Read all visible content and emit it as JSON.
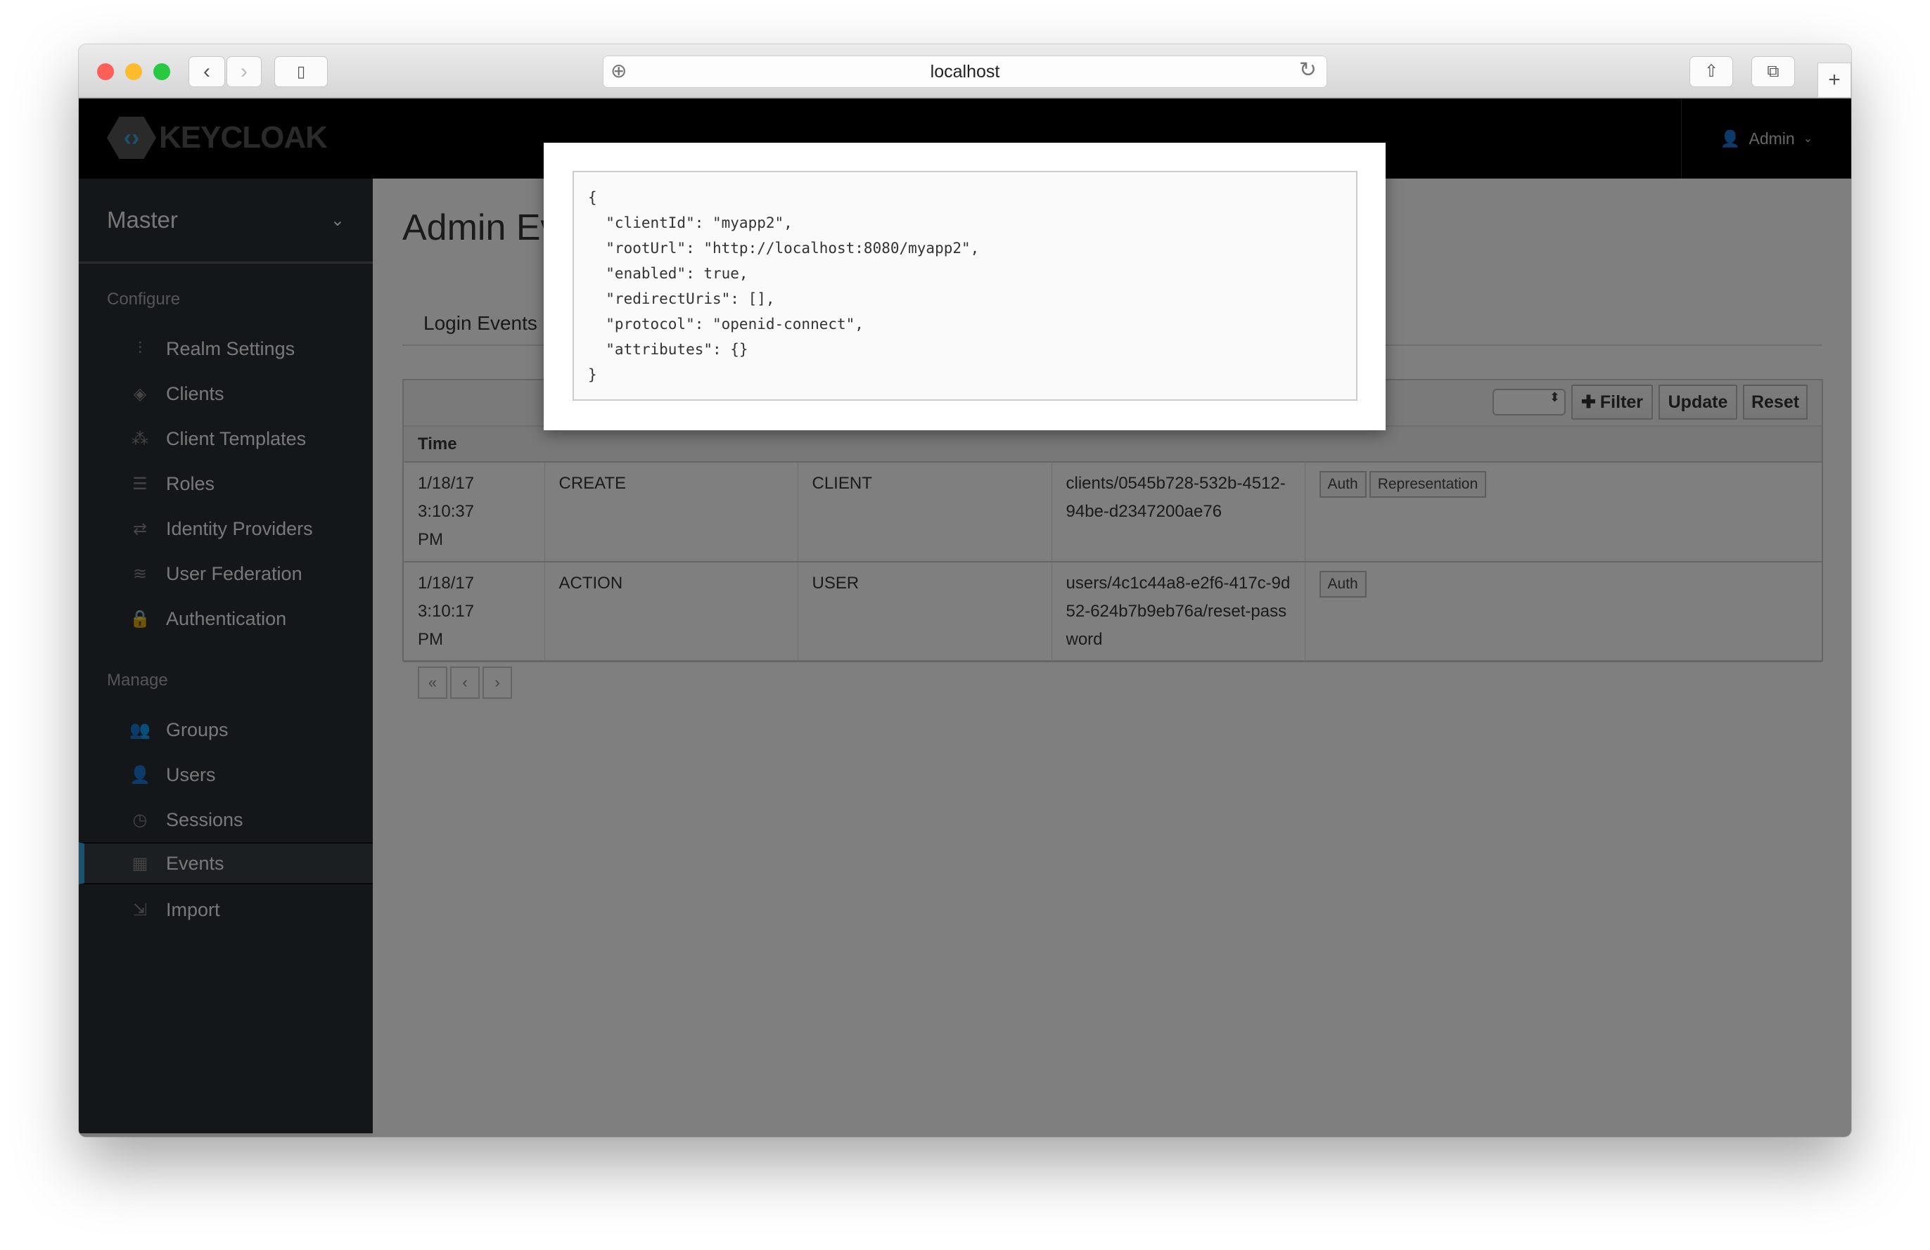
{
  "browser": {
    "url": "localhost"
  },
  "header": {
    "logo": "KEYCLOAK",
    "user": "Admin"
  },
  "sidebar": {
    "realm": "Master",
    "configure_label": "Configure",
    "manage_label": "Manage",
    "configure": [
      {
        "label": "Realm Settings",
        "icon": "sliders-icon"
      },
      {
        "label": "Clients",
        "icon": "cube-icon"
      },
      {
        "label": "Client Templates",
        "icon": "cubes-icon"
      },
      {
        "label": "Roles",
        "icon": "list-icon"
      },
      {
        "label": "Identity Providers",
        "icon": "exchange-icon"
      },
      {
        "label": "User Federation",
        "icon": "database-icon"
      },
      {
        "label": "Authentication",
        "icon": "lock-icon"
      }
    ],
    "manage": [
      {
        "label": "Groups",
        "icon": "users-icon"
      },
      {
        "label": "Users",
        "icon": "user-icon"
      },
      {
        "label": "Sessions",
        "icon": "clock-icon"
      },
      {
        "label": "Events",
        "icon": "calendar-icon",
        "active": true
      },
      {
        "label": "Import",
        "icon": "import-icon"
      }
    ]
  },
  "main": {
    "title": "Admin Ev",
    "tabs": [
      {
        "label": "Login Events"
      }
    ],
    "toolbar": {
      "filter": "Filter",
      "update": "Update",
      "reset": "Reset"
    },
    "table": {
      "headers": [
        "Time"
      ],
      "rows": [
        {
          "time": "1/18/17 3:10:37 PM",
          "operation": "CREATE",
          "resource": "CLIENT",
          "path": "clients/0545b728-532b-4512-94be-d2347200ae76",
          "actions": [
            "Auth",
            "Representation"
          ]
        },
        {
          "time": "1/18/17 3:10:17 PM",
          "operation": "ACTION",
          "resource": "USER",
          "path": "users/4c1c44a8-e2f6-417c-9d52-624b7b9eb76a/reset-password",
          "actions": [
            "Auth"
          ]
        }
      ]
    },
    "pager": [
      "«",
      "‹",
      "›"
    ]
  },
  "modal": {
    "json": "{\n  \"clientId\": \"myapp2\",\n  \"rootUrl\": \"http://localhost:8080/myapp2\",\n  \"enabled\": true,\n  \"redirectUris\": [],\n  \"protocol\": \"openid-connect\",\n  \"attributes\": {}\n}"
  },
  "colors": {
    "accent": "#39a5dc",
    "sidebar": "#292e34",
    "header": "#000000"
  }
}
